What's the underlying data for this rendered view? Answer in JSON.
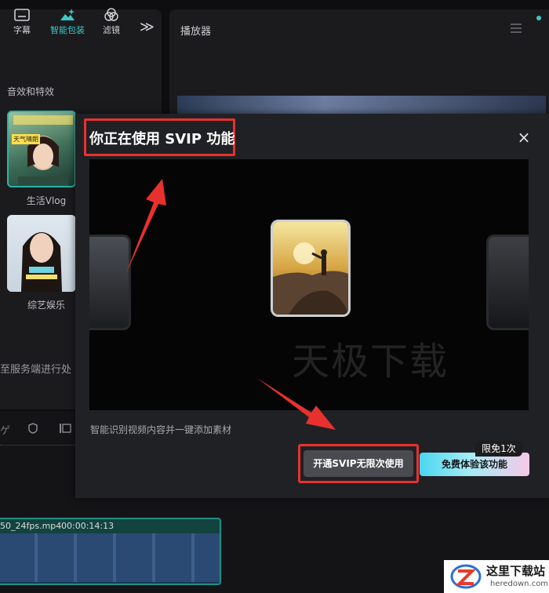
{
  "left_panel": {
    "tabs": [
      {
        "label": "字幕",
        "icon": "subtitle-icon"
      },
      {
        "label": "智能包装",
        "icon": "smart-pack-icon"
      },
      {
        "label": "滤镜",
        "icon": "filter-icon"
      }
    ],
    "more_icon": "double-chevron-right-icon",
    "section_title": "音效和特效",
    "templates": [
      {
        "label": "生活Vlog",
        "overlay_text": "天气晴朗"
      },
      {
        "label": "综艺娱乐"
      }
    ],
    "status_text": "至服务端进行处"
  },
  "player": {
    "title": "播放器",
    "menu_icon": "hamburger-menu-icon"
  },
  "timeline": {
    "clip_name": "50_24fps.mp4",
    "clip_duration": "00:00:14:13"
  },
  "modal": {
    "title": "你正在使用 SVIP 功能",
    "close_symbol": "×",
    "description": "智能识别视频内容并一键添加素材",
    "watermark": "天极下载",
    "vip_button_label": "开通SVIP无限次使用",
    "trial_button_label": "免费体验该功能",
    "trial_badge": "限免1次"
  },
  "site_logo": {
    "title": "这里下载站",
    "url": "heredown.com"
  },
  "colors": {
    "accent_teal": "#3ec7c7",
    "annotation_red": "#e8312f",
    "modal_bg": "#202124"
  }
}
